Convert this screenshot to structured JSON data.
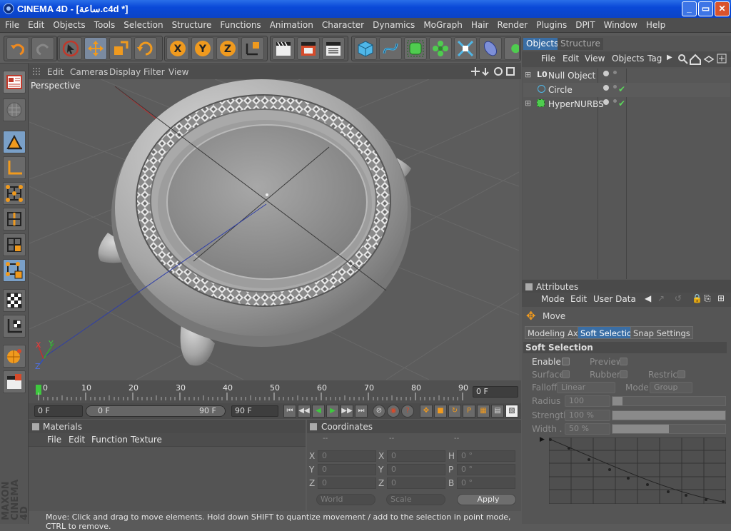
{
  "window": {
    "title": "CINEMA 4D - [ساعة.c4d *]",
    "minimize": "_",
    "restore": "▭",
    "close": "✕"
  },
  "menu": [
    "File",
    "Edit",
    "Objects",
    "Tools",
    "Selection",
    "Structure",
    "Functions",
    "Animation",
    "Character",
    "Dynamics",
    "MoGraph",
    "Hair",
    "Render",
    "Plugins",
    "DPIT",
    "Window",
    "Help"
  ],
  "viewport_menu": {
    "edit": "Edit",
    "cameras": "Cameras",
    "display": "Display",
    "filter": "Filter",
    "view": "View",
    "label": "Perspective"
  },
  "axis_labels": {
    "x": "X",
    "y": "Y",
    "z": "Z"
  },
  "timeline": {
    "ticks": [
      "0",
      "10",
      "20",
      "30",
      "40",
      "50",
      "60",
      "70",
      "80",
      "90"
    ],
    "current_frame": "0 F",
    "start": "0 F",
    "range_start": "0 F",
    "range_end": "90 F",
    "end": "90 F"
  },
  "materials": {
    "title": "Materials",
    "menu": [
      "File",
      "Edit",
      "Function",
      "Texture"
    ]
  },
  "coordinates": {
    "title": "Coordinates",
    "col_heads": [
      "--",
      "--",
      "--"
    ],
    "rows": [
      {
        "a": "X",
        "av": "0",
        "b": "X",
        "bv": "0",
        "c": "H",
        "cv": "0 °"
      },
      {
        "a": "Y",
        "av": "0",
        "b": "Y",
        "bv": "0",
        "c": "P",
        "cv": "0 °"
      },
      {
        "a": "Z",
        "av": "0",
        "b": "Z",
        "bv": "0",
        "c": "B",
        "cv": "0 °"
      }
    ],
    "world": "World",
    "scale": "Scale",
    "apply": "Apply"
  },
  "status": "Move: Click and drag to move elements. Hold down SHIFT to quantize movement / add to the selection in point mode, CTRL to remove.",
  "objects": {
    "tabs": [
      "Objects",
      "Structure"
    ],
    "menu": [
      "File",
      "Edit",
      "View",
      "Objects",
      "Tag"
    ],
    "items": [
      {
        "name": "Null Object",
        "check": ""
      },
      {
        "name": "Circle",
        "check": "✔"
      },
      {
        "name": "HyperNURBS",
        "check": "✔"
      }
    ]
  },
  "attributes": {
    "title": "Attributes",
    "menu": [
      "Mode",
      "Edit",
      "User Data"
    ],
    "tool": "Move",
    "tabs": [
      "Modeling Axis",
      "Soft Selection",
      "Snap Settings"
    ],
    "section": "Soft Selection",
    "enable": "Enable",
    "preview": "Preview",
    "surface": "Surface",
    "rubber": "Rubber",
    "restrict": "Restrict",
    "falloff": "Falloff",
    "falloff_val": "Linear",
    "mode": "Mode",
    "mode_val": "Group",
    "radius": "Radius",
    "radius_val": "100",
    "strength": "Strength",
    "strength_val": "100 %",
    "width": "Width . .",
    "width_val": "50 %",
    "radius_frac": 0.0,
    "strength_frac": 1.0,
    "width_frac": 0.5
  },
  "brand": "MAXON CINEMA 4D",
  "colors": {
    "accent": "#ff8a1e",
    "selected_tab": "#3a6ea5",
    "titlebar": "#0a49d8"
  }
}
